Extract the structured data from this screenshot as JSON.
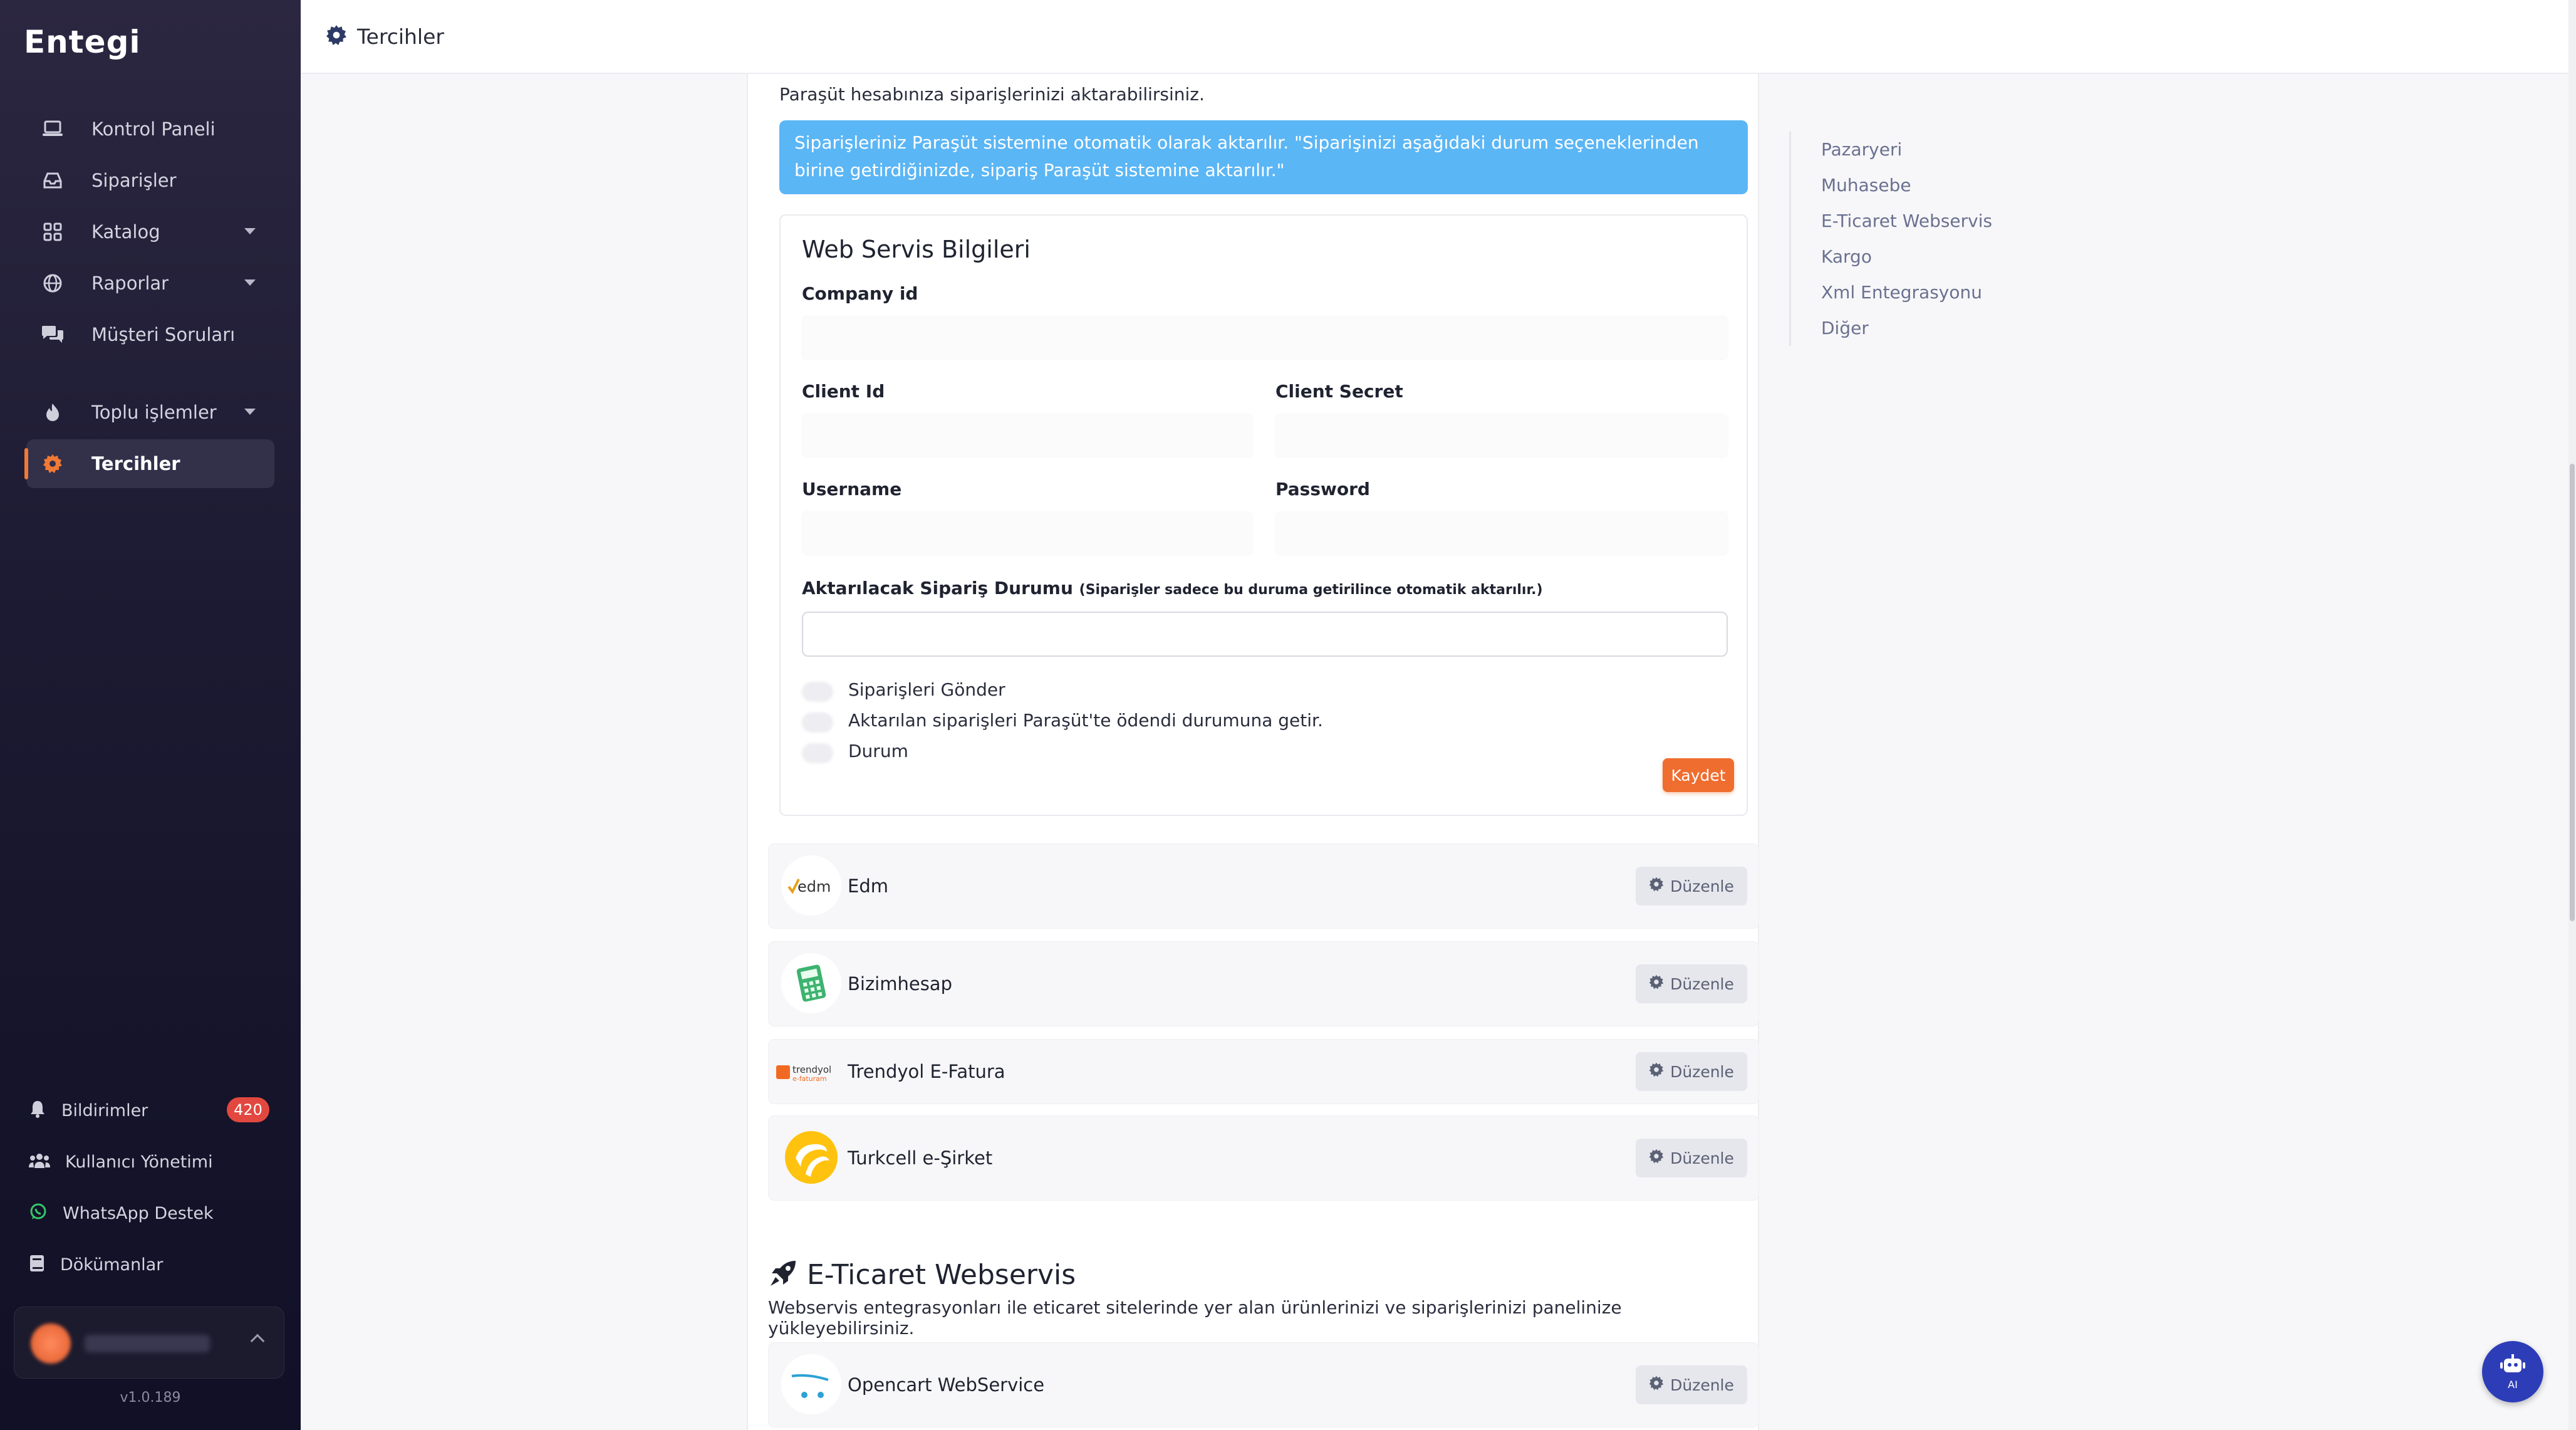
{
  "app": {
    "logo": "Entegi",
    "version": "v1.0.189"
  },
  "sidebar": {
    "items": [
      {
        "label": "Kontrol Paneli",
        "icon": "laptop-icon"
      },
      {
        "label": "Siparişler",
        "icon": "inbox-icon"
      },
      {
        "label": "Katalog",
        "icon": "grid-icon",
        "has_submenu": true
      },
      {
        "label": "Raporlar",
        "icon": "globe-icon",
        "has_submenu": true
      },
      {
        "label": "Müşteri Soruları",
        "icon": "chat-icon"
      },
      {
        "label": "Toplu işlemler",
        "icon": "fire-icon",
        "has_submenu": true
      },
      {
        "label": "Tercihler",
        "icon": "gear-icon",
        "active": true
      }
    ],
    "bottom": [
      {
        "label": "Bildirimler",
        "icon": "bell-icon",
        "badge": "420"
      },
      {
        "label": "Kullanıcı Yönetimi",
        "icon": "users-icon"
      },
      {
        "label": "WhatsApp Destek",
        "icon": "whatsapp-icon"
      },
      {
        "label": "Dökümanlar",
        "icon": "book-icon"
      }
    ]
  },
  "header": {
    "title": "Tercihler"
  },
  "main": {
    "intro": "Paraşüt hesabınıza siparişlerinizi aktarabilirsiniz.",
    "alert": "Siparişleriniz Paraşüt sistemine otomatik olarak aktarılır. \"Siparişinizi aşağıdaki durum seçeneklerinden birine getirdiğinizde, sipariş Paraşüt sistemine aktarılır.\"",
    "form": {
      "title": "Web Servis Bilgileri",
      "company_id_label": "Company id",
      "client_id_label": "Client Id",
      "client_secret_label": "Client Secret",
      "username_label": "Username",
      "password_label": "Password",
      "status_label": "Aktarılacak Sipariş Durumu",
      "status_hint": "(Siparişler sadece bu duruma getirilince otomatik aktarılır.)",
      "toggles": [
        "Siparişleri Gönder",
        "Aktarılan siparişleri Paraşüt'te ödendi durumuna getir.",
        "Durum"
      ],
      "save_label": "Kaydet"
    },
    "integrations": [
      {
        "name": "Edm",
        "edit_label": "Düzenle"
      },
      {
        "name": "Bizimhesap",
        "edit_label": "Düzenle"
      },
      {
        "name": "Trendyol E-Fatura",
        "edit_label": "Düzenle"
      },
      {
        "name": "Turkcell e-Şirket",
        "edit_label": "Düzenle"
      }
    ],
    "ecommerce_section": {
      "title": "E-Ticaret Webservis",
      "description": "Webservis entegrasyonları ile eticaret sitelerinde yer alan ürünlerinizi ve siparişlerinizi panelinize yükleyebilirsiniz.",
      "items": [
        {
          "name": "Opencart WebService",
          "edit_label": "Düzenle"
        }
      ]
    }
  },
  "right_nav": [
    "Pazaryeri",
    "Muhasebe",
    "E-Ticaret Webservis",
    "Kargo",
    "Xml Entegrasyonu",
    "Diğer"
  ],
  "ai_button": {
    "label": "AI"
  },
  "colors": {
    "accent": "#ef6d2f",
    "alert": "#5bb6f5",
    "badge": "#e2483f",
    "ai": "#2d3db8"
  }
}
